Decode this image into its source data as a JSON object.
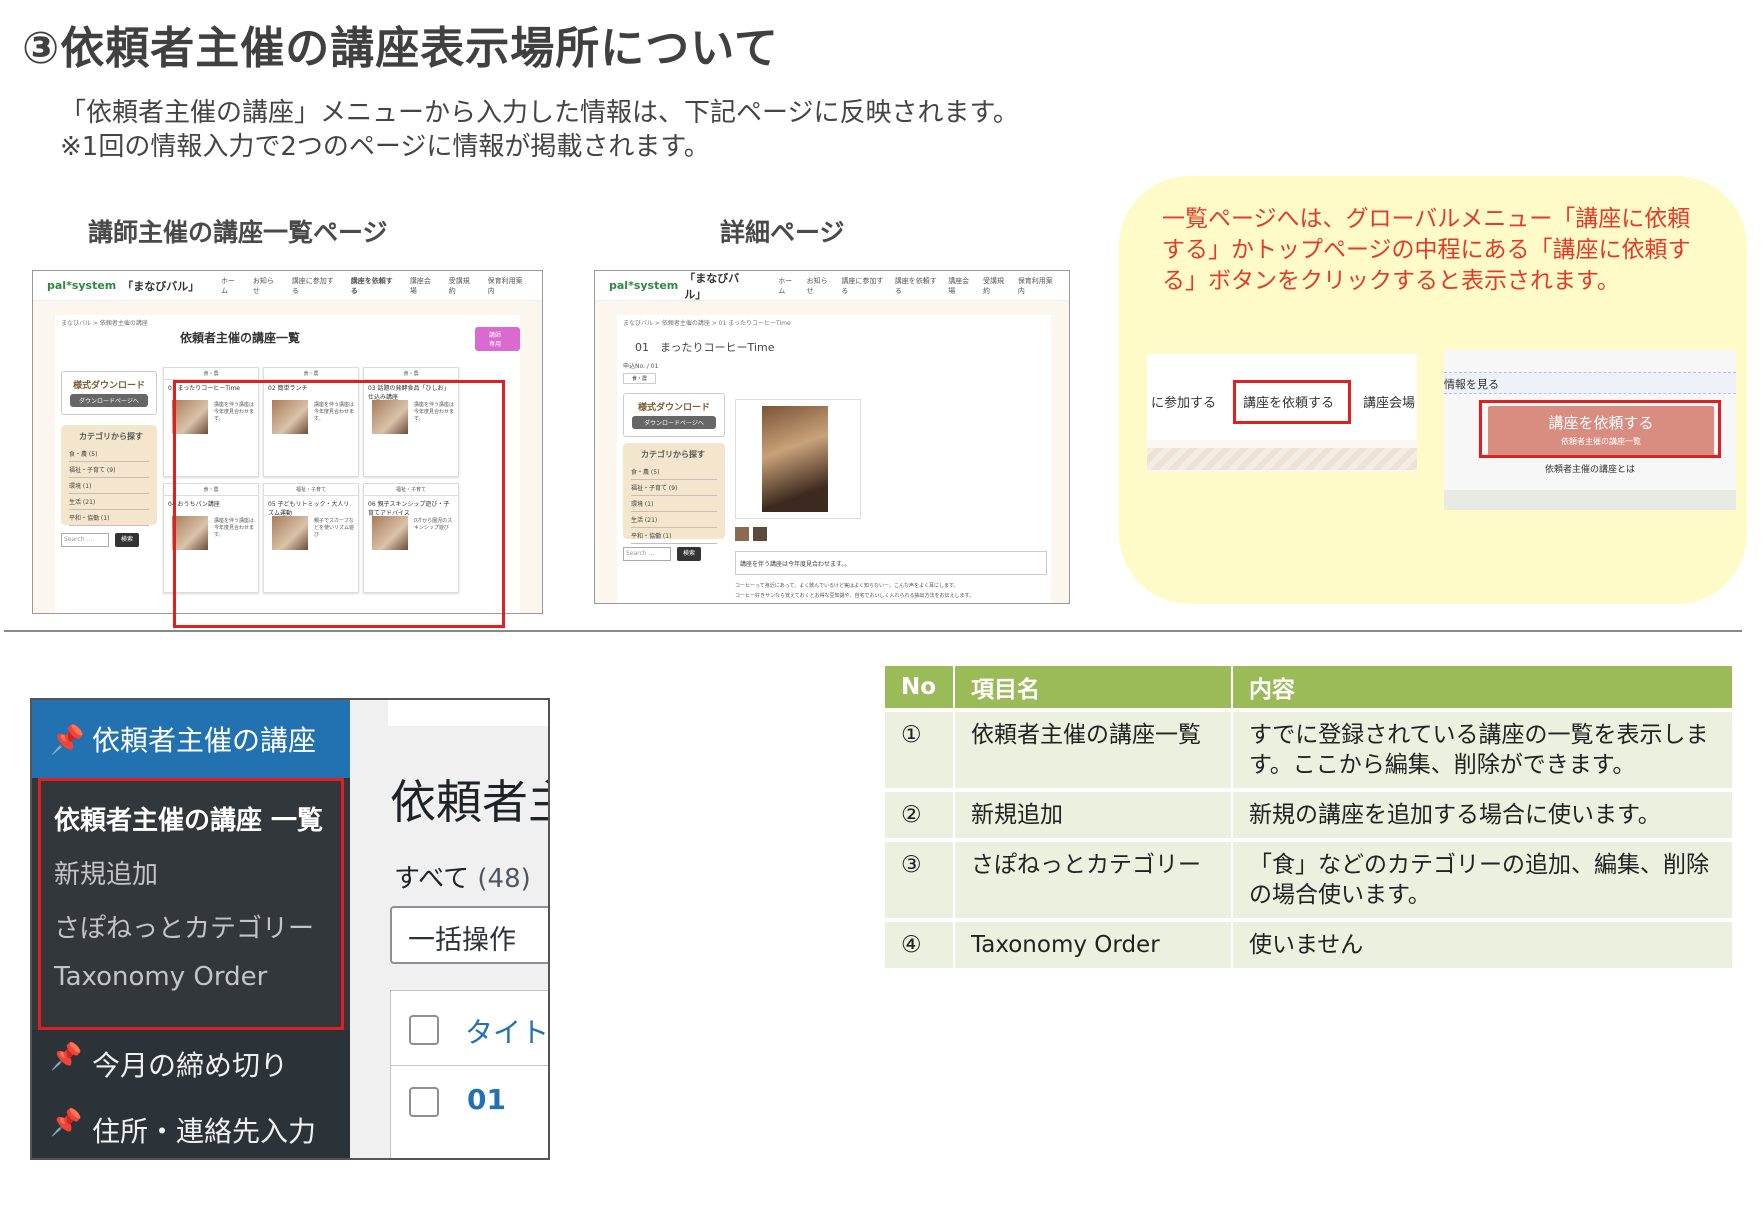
{
  "title": "③依頼者主催の講座表示場所について",
  "intro": {
    "line1": "「依頼者主催の講座」メニューから入力した情報は、下記ページに反映されます。",
    "line2": "※1回の情報入力で2つのページに情報が掲載されます。"
  },
  "labels": {
    "list_page": "講師主催の講座一覧ページ",
    "detail_page": "詳細ページ"
  },
  "site": {
    "logo": "pal*system",
    "logo_sub": "「まなびバル」",
    "nav": [
      "ホーム",
      "お知らせ",
      "講座に参加する",
      "講座を依頼する",
      "講座会場",
      "受講規約",
      "保育利用案内"
    ],
    "breadcrumb_list": "まなびバル > 依頼者主催の講座",
    "breadcrumb_detail": "まなびバル > 依頼者主催の講座 > 01 まったりコーヒーTime",
    "list_heading": "依頼者主催の講座一覧",
    "list_button": "講師専用",
    "download_title": "様式ダウンロード",
    "download_btn": "ダウンロードページへ",
    "category_title": "カテゴリから探す",
    "categories": [
      "食・農 (5)",
      "福祉・子育て (9)",
      "環境 (1)",
      "生活 (21)",
      "平和・協働 (1)"
    ],
    "search_placeholder": "Search …",
    "search_button": "検索",
    "cards": [
      {
        "tag": "食・農",
        "title": "01 まったりコーヒーTime",
        "text": "講座を伴う講座は今年度見合わせます。"
      },
      {
        "tag": "食・農",
        "title": "02 簡単ランチ",
        "text": "講座を伴う講座は今年度見合わせます。"
      },
      {
        "tag": "食・農",
        "title": "03 話題の発酵食品「ひしお」仕込み講座",
        "text": "講座を伴う講座は今年度見合わせます。"
      },
      {
        "tag": "食・農",
        "title": "04 おうちパン講座",
        "text": "講座を伴う講座は今年度見合わせます。"
      },
      {
        "tag": "福祉・子育て",
        "title": "05 子どもリトミック・大人リズム運動",
        "text": "親子でスカーフなどを使いリズム遊び"
      },
      {
        "tag": "福祉・子育て",
        "title": "06 親子スキンシップ遊び・子育てアドバイス",
        "text": "0才から園児のスキンシップ遊び"
      }
    ],
    "detail_title": "01　まったりコーヒーTime",
    "detail_no": "申込No. / 01",
    "detail_tag": "食・農",
    "detail_note": "講座を伴う講座は今年度見合わせます。。",
    "detail_desc1": "コーヒーって身近にあって、よく飲んでいるけど実はよく知らないー。こんな声をよく耳にします。",
    "detail_desc2": "コーヒー好きサンなら覚えておくとお得な豆知識や、自宅でおいしく入れられる抽出方法をお伝えします。"
  },
  "callout": {
    "text": "一覧ページへは、グローバルメニュー「講座に依頼する」かトップページの中程にある「講座に依頼する」ボタンをクリックすると表示されます。",
    "menu_left": "に参加する",
    "menu_target": "講座を依頼する",
    "menu_right": "講座会場",
    "info_link": "情報を見る",
    "btn_main": "講座を依頼する",
    "btn_sub": "依頼者主催の講座一覧",
    "about": "依頼者主催の講座とは"
  },
  "wp": {
    "active_menu": "依頼者主催の講座",
    "submenu": [
      "依頼者主催の講座 一覧",
      "新規追加",
      "さぽねっとカテゴリー",
      "Taxonomy Order"
    ],
    "other_menu": [
      "今月の締め切り",
      "住所・連絡先入力"
    ],
    "page_heading": "依頼者主",
    "filter_all": "すべて",
    "filter_count": "(48)",
    "bulk": "一括操作",
    "col_title": "タイト",
    "row1": "01"
  },
  "table": {
    "headers": [
      "No",
      "項目名",
      "内容"
    ],
    "rows": [
      {
        "no": "①",
        "name": "依頼者主催の講座一覧",
        "desc": "すでに登録されている講座の一覧を表示します。ここから編集、削除ができます。"
      },
      {
        "no": "②",
        "name": "新規追加",
        "desc": "新規の講座を追加する場合に使います。"
      },
      {
        "no": "③",
        "name": "さぽねっとカテゴリー",
        "desc": "「食」などのカテゴリーの追加、編集、削除の場合使います。"
      },
      {
        "no": "④",
        "name": "Taxonomy Order",
        "desc": "使いません"
      }
    ]
  },
  "colors": {
    "highlight": "#e02020",
    "callout_bg": "#fffbc8",
    "callout_text": "#e53a2a",
    "table_header": "#9bbb59",
    "table_row": "#ebf1de",
    "wp_active": "#2271b1",
    "wp_side": "#2c3338"
  }
}
